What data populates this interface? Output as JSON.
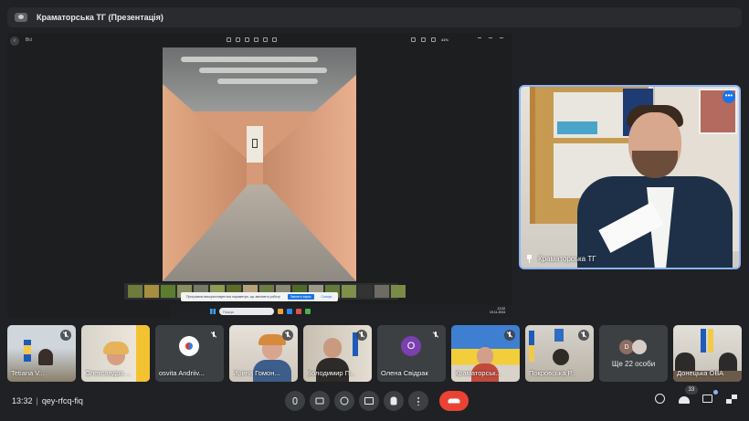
{
  "meeting": {
    "title": "Краматорська ТГ (Презентація)",
    "time": "13:32",
    "code": "qey-rfcq-fiq",
    "people_count": "33"
  },
  "viewer": {
    "back_label": "Всі",
    "zoom": "41%",
    "notice_text": "Програмою використовуються параметри, що змінюють роботу",
    "notice_button": "Змінити зараз",
    "notice_link": "Скасув.",
    "search_placeholder": "Пошук",
    "clock_time": "13:32",
    "clock_date": "19.11.2024"
  },
  "speaker": {
    "name": "Краматорська ТГ"
  },
  "participants": [
    {
      "name": "Tetiana V...",
      "muted": true
    },
    {
      "name": "Олександра ...",
      "muted": false
    },
    {
      "name": "osvita Andriiv...",
      "muted": true,
      "avatar": "logo"
    },
    {
      "name": "Ирина Гомон...",
      "muted": true
    },
    {
      "name": "Володимир П...",
      "muted": true
    },
    {
      "name": "Олена Свідрак",
      "muted": true,
      "avatar_letter": "О",
      "avatar_color": "#7b3fb0"
    },
    {
      "name": "Краматорськ...",
      "muted": true
    },
    {
      "name": "Покровська Р...",
      "muted": true
    },
    {
      "more_label": "Ще 22 особи",
      "mini_letter": "D"
    },
    {
      "name": "Донецька ОВА",
      "muted": false
    }
  ],
  "colors": {
    "background": "#202124",
    "accent": "#8ab4f8",
    "hangup": "#ea4335",
    "control": "#3c4043"
  },
  "icons": [
    "present-icon",
    "pin-icon",
    "more-vert-icon",
    "mic-off-icon",
    "mic-icon",
    "camera-icon",
    "emoji-icon",
    "present-screen-icon",
    "raise-hand-icon",
    "more-options-icon",
    "hangup-icon",
    "info-icon",
    "people-icon",
    "chat-icon",
    "activities-icon"
  ]
}
